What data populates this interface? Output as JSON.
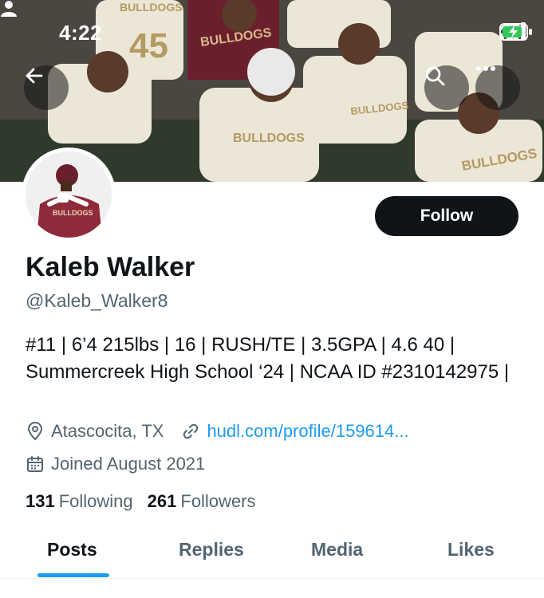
{
  "status_bar": {
    "time": "4:22"
  },
  "banner": {
    "jersey_numbers": [
      "45"
    ],
    "jersey_text": [
      "BULLDOGS",
      "BULLDOGS",
      "BULLDOGS",
      "BULLDOGS",
      "BULLDOGS"
    ]
  },
  "profile": {
    "name": "Kaleb Walker",
    "handle": "@Kaleb_Walker8",
    "bio": "#11 | 6’4 215lbs | 16 | RUSH/TE | 3.5GPA | 4.6 40 | Summercreek High School ‘24 | NCAA ID #2310142975 |",
    "location": "Atascocita, TX",
    "link": "hudl.com/profile/159614...",
    "joined": "Joined August 2021",
    "following_count": "131",
    "following_label": "Following",
    "followers_count": "261",
    "followers_label": "Followers",
    "avatar_jersey_text": "BULLDOGS"
  },
  "actions": {
    "follow_label": "Follow"
  },
  "tabs": [
    {
      "label": "Posts",
      "active": true
    },
    {
      "label": "Replies",
      "active": false
    },
    {
      "label": "Media",
      "active": false
    },
    {
      "label": "Likes",
      "active": false
    }
  ],
  "colors": {
    "accent": "#1d9bf0",
    "text": "#0f1419",
    "muted": "#536471",
    "battery": "#34c759",
    "team_maroon": "#6b1f2c",
    "team_gold": "#c9b48a"
  },
  "icons": [
    "person-icon",
    "signal-icon",
    "wifi-icon",
    "battery-icon",
    "back-arrow-icon",
    "search-icon",
    "more-icon",
    "location-pin-icon",
    "link-icon",
    "calendar-icon"
  ]
}
